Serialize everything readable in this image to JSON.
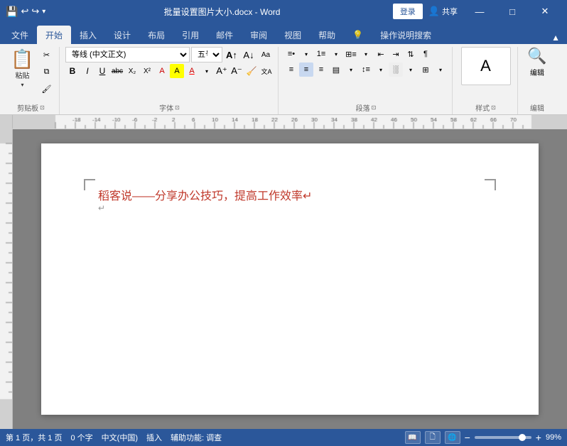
{
  "titlebar": {
    "filename": "批量设置图片大小.docx - Word",
    "login": "登录",
    "share": "共享",
    "controls": {
      "min": "—",
      "max": "□",
      "close": "✕"
    }
  },
  "quick_access": [
    "💾",
    "↩",
    "↪",
    "⟳"
  ],
  "ribbon": {
    "tabs": [
      "文件",
      "开始",
      "插入",
      "设计",
      "布局",
      "引用",
      "邮件",
      "审阅",
      "视图",
      "帮助",
      "💡",
      "操作说明搜索"
    ],
    "active_tab": "开始",
    "groups": {
      "clipboard": {
        "label": "剪贴板",
        "paste": "粘贴",
        "cut": "✂",
        "copy": "⧉",
        "format": "🖌"
      },
      "font": {
        "label": "字体",
        "name": "等线 (中文正文)",
        "size": "五号",
        "bold": "B",
        "italic": "I",
        "underline": "U",
        "strikethrough": "abc"
      },
      "paragraph": {
        "label": "段落"
      },
      "styles": {
        "label": "样式"
      },
      "editing": {
        "label": "编辑"
      }
    }
  },
  "document": {
    "title_text": "稻客说——分享办公技巧，提高工作效率↵",
    "paragraph_mark": "↵"
  },
  "statusbar": {
    "page": "第 1 页，共 1 页",
    "words": "0 个字",
    "lang": "中文(中国)",
    "mode": "插入",
    "accessibility": "辅助功能: 调查",
    "zoom": "99%",
    "zoom_minus": "−",
    "zoom_plus": "+"
  }
}
